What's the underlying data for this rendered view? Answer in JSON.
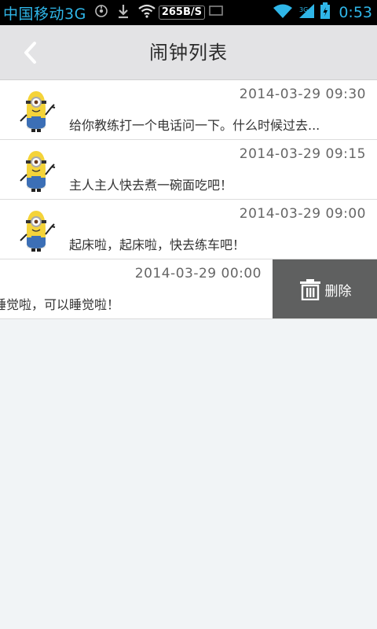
{
  "status_bar": {
    "carrier": "中国移动3G",
    "net_speed": "265B/S",
    "time": "0:53",
    "icons": [
      "usb-icon",
      "download-icon",
      "wifi-icon",
      "signal-icon",
      "battery-icon"
    ]
  },
  "header": {
    "title": "闹钟列表",
    "back_icon": "chevron-left-icon"
  },
  "alarms": [
    {
      "time": "2014-03-29 09:30",
      "message": "给你教练打一个电话问一下。什么时候过去..."
    },
    {
      "time": "2014-03-29 09:15",
      "message": "主人主人快去煮一碗面吃吧！"
    },
    {
      "time": "2014-03-29 09:00",
      "message": "起床啦，起床啦，快去练车吧！"
    },
    {
      "time": "2014-03-29 00:00",
      "message": "睡觉啦，可以睡觉啦！"
    }
  ],
  "delete_action": {
    "label": "删除",
    "icon": "trash-icon"
  },
  "colors": {
    "status_accent": "#2fb6e8",
    "header_bg": "#e3e3e5",
    "delete_bg": "#5f6060",
    "page_bg": "#f1f4f6"
  }
}
